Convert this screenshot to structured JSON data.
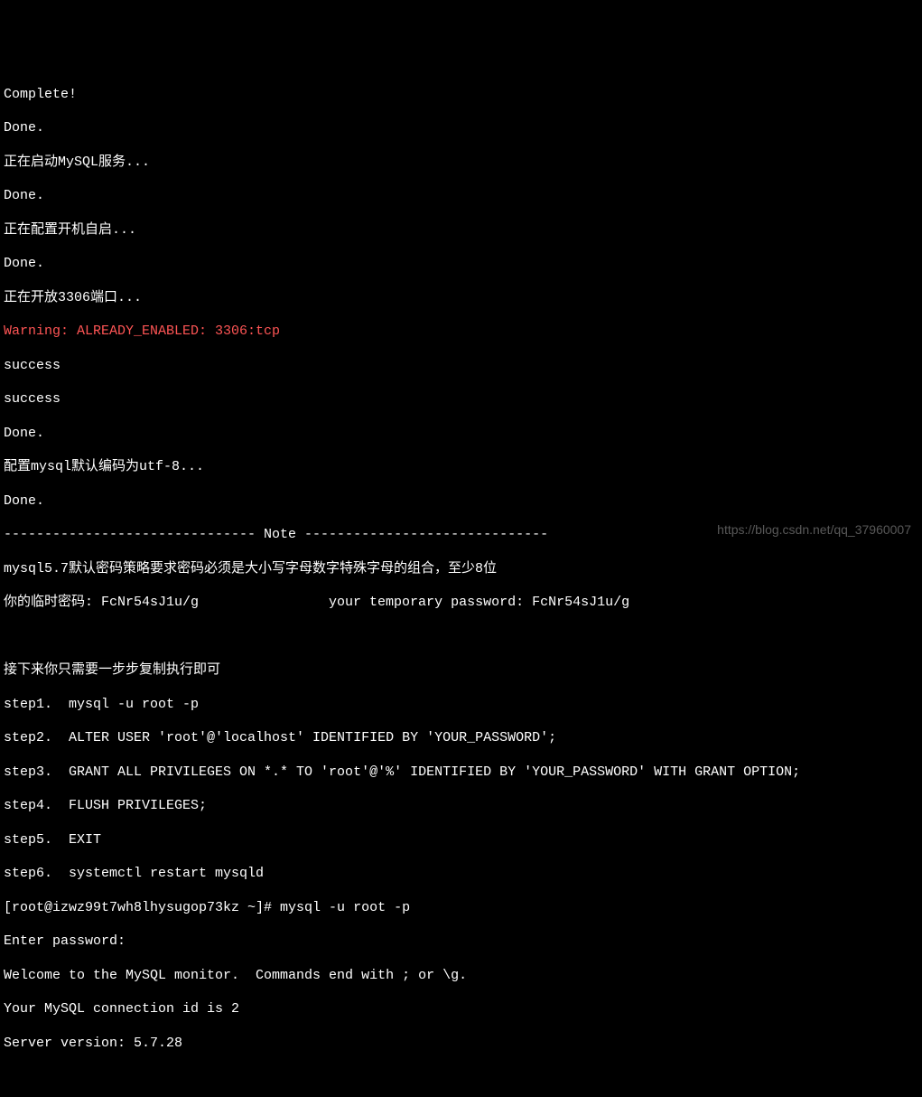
{
  "lines": {
    "l1": "Complete!",
    "l2": "Done.",
    "l3": "正在启动MySQL服务...",
    "l4": "Done.",
    "l5": "正在配置开机自启...",
    "l6": "Done.",
    "l7": "正在开放3306端口...",
    "l8": "Warning: ALREADY_ENABLED: 3306:tcp",
    "l9": "success",
    "l10": "success",
    "l11": "Done.",
    "l12": "配置mysql默认编码为utf-8...",
    "l13": "Done.",
    "l14": "------------------------------- Note ------------------------------",
    "l15": "mysql5.7默认密码策略要求密码必须是大小写字母数字特殊字母的组合，至少8位",
    "l16": "你的临时密码: FcNr54sJ1u/g                your temporary password: FcNr54sJ1u/g",
    "l17": "",
    "l18": "",
    "l19": "接下来你只需要一步步复制执行即可",
    "l20": "step1.  mysql -u root -p",
    "l21": "step2.  ALTER USER 'root'@'localhost' IDENTIFIED BY 'YOUR_PASSWORD';",
    "l22": "step3.  GRANT ALL PRIVILEGES ON *.* TO 'root'@'%' IDENTIFIED BY 'YOUR_PASSWORD' WITH GRANT OPTION;",
    "l23": "step4.  FLUSH PRIVILEGES;",
    "l24": "step5.  EXIT",
    "l25": "step6.  systemctl restart mysqld",
    "l26": "[root@izwz99t7wh8lhysugop73kz ~]# mysql -u root -p",
    "l27": "Enter password:",
    "l28": "Welcome to the MySQL monitor.  Commands end with ; or \\g.",
    "l29": "Your MySQL connection id is 2",
    "l30": "Server version: 5.7.28"
  },
  "watermark": "https://blog.csdn.net/qq_37960007"
}
